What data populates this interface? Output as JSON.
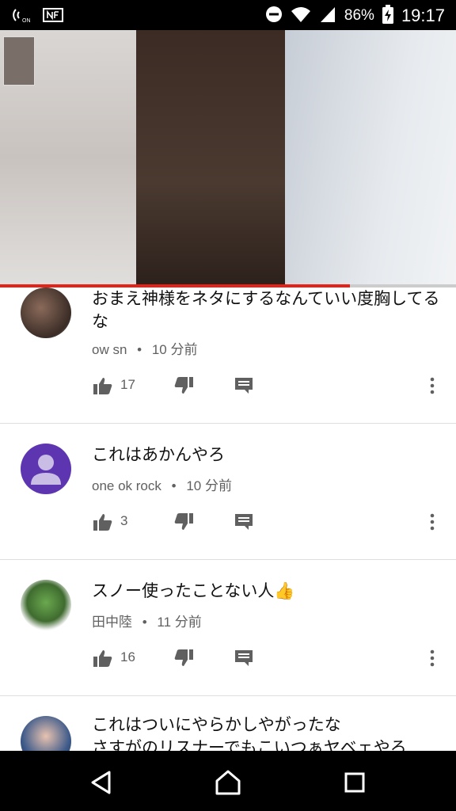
{
  "status_bar": {
    "battery_percent": "86%",
    "time": "19:17"
  },
  "video": {
    "progress_fraction": 0.767
  },
  "comments": [
    {
      "text": "おまえ神様をネタにするなんていい度胸してるな",
      "author": "ow sn",
      "time": "10 分前",
      "likes": "17"
    },
    {
      "text": "これはあかんやろ",
      "author": "one ok rock",
      "time": "10 分前",
      "likes": "3"
    },
    {
      "text": "スノー使ったことない人👍",
      "author": "田中陸",
      "time": "11 分前",
      "likes": "16"
    },
    {
      "text": "これはついにやらかしやがったな\nさすがのリスナーでもこいつぁヤベェやろ"
    }
  ],
  "meta_separator": "•",
  "colors": {
    "progress": "#e62117",
    "default_avatar_bg": "#5e35b1",
    "text_secondary": "#606060"
  }
}
